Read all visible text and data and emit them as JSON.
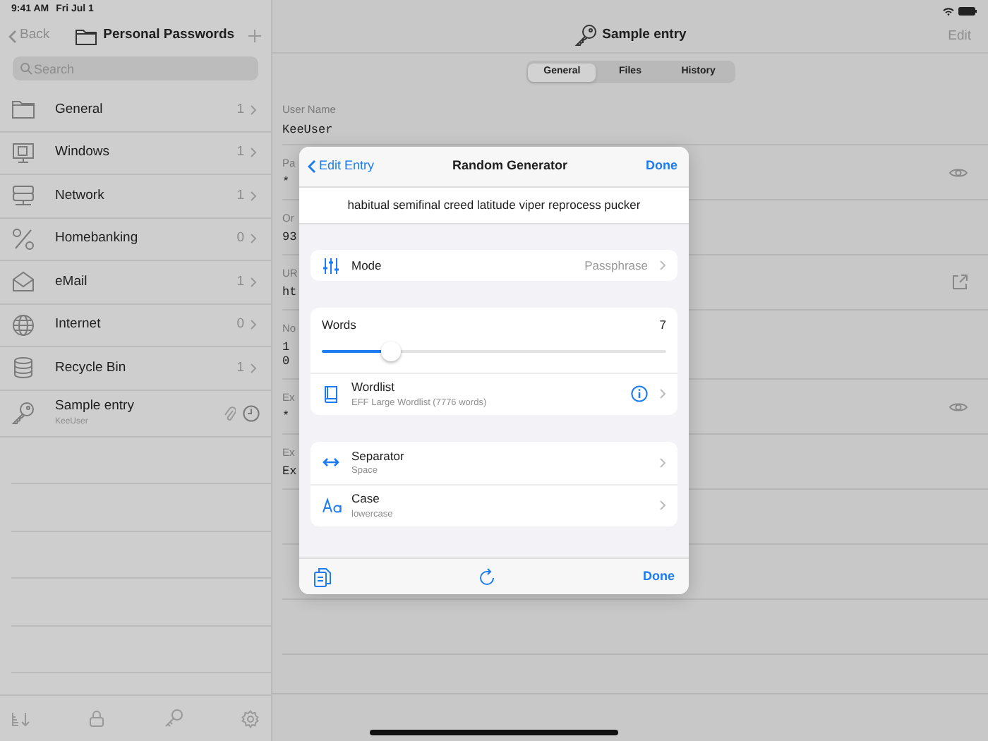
{
  "status_bar": {
    "time": "9:41 AM",
    "date": "Fri Jul 1"
  },
  "sidebar": {
    "back": "Back",
    "title": "Personal Passwords",
    "search": {
      "placeholder": "Search"
    },
    "groups": [
      {
        "name": "General",
        "count": "1"
      },
      {
        "name": "Windows",
        "count": "1"
      },
      {
        "name": "Network",
        "count": "1"
      },
      {
        "name": "Homebanking",
        "count": "0"
      },
      {
        "name": "eMail",
        "count": "1"
      },
      {
        "name": "Internet",
        "count": "0"
      },
      {
        "name": "Recycle Bin",
        "count": "1"
      }
    ],
    "entries": [
      {
        "title": "Sample entry",
        "username": "KeeUser"
      }
    ]
  },
  "entry": {
    "title": "Sample entry",
    "edit": "Edit",
    "tabs": [
      {
        "label": "General",
        "selected": true
      },
      {
        "label": "Files",
        "selected": false
      },
      {
        "label": "History",
        "selected": false
      }
    ],
    "fields": [
      {
        "label": "User Name",
        "value": "KeeUser"
      },
      {
        "label": "Pa",
        "value": "*"
      },
      {
        "label": "Or",
        "value": "93"
      },
      {
        "label": "UR",
        "value": "ht"
      },
      {
        "label": "No",
        "value": "1\n0"
      },
      {
        "label": "Ex",
        "value": "*"
      },
      {
        "label": "Ex",
        "value": "Ex"
      }
    ]
  },
  "generator": {
    "back": "Edit Entry",
    "title": "Random Generator",
    "done": "Done",
    "result": "habitual semifinal creed latitude viper reprocess pucker",
    "mode": {
      "label": "Mode",
      "value": "Passphrase"
    },
    "words": {
      "label": "Words",
      "value": "7",
      "level": 0.2
    },
    "wordlist": {
      "label": "Wordlist",
      "detail": "EFF Large Wordlist (7776 words)"
    },
    "options": [
      {
        "kind": "separator",
        "label": "Separator",
        "detail": "Space"
      },
      {
        "kind": "case",
        "label": "Case",
        "detail": "lowercase"
      }
    ],
    "footer_done": "Done"
  }
}
